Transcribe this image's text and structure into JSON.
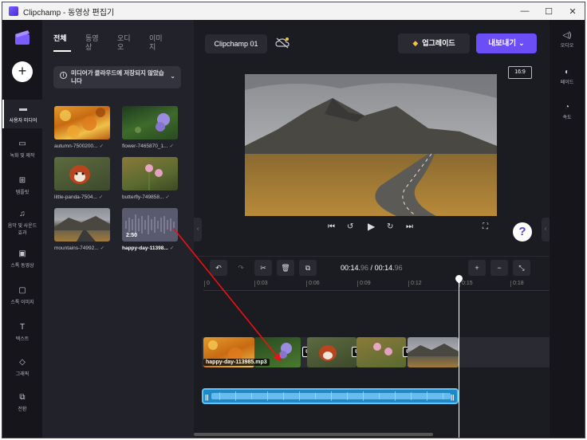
{
  "window": {
    "title": "Clipchamp - 동영상 편집기",
    "controls": [
      "—",
      "☐",
      "✕"
    ]
  },
  "left_nav": {
    "plus": "+",
    "items": [
      {
        "label": "사용자 미디어",
        "icon": "folder-icon",
        "glyph": "▬"
      },
      {
        "label": "녹화 및 제작",
        "icon": "camera-icon",
        "glyph": "▭"
      },
      {
        "label": "템플릿",
        "icon": "template-icon",
        "glyph": "⊞"
      },
      {
        "label": "음악 및 사운드 효과",
        "icon": "music-icon",
        "glyph": "♫"
      },
      {
        "label": "스톡 동영상",
        "icon": "film-icon",
        "glyph": "▣"
      },
      {
        "label": "스톡 이미지",
        "icon": "image-icon",
        "glyph": "▢"
      },
      {
        "label": "텍스트",
        "icon": "text-icon",
        "glyph": "T"
      },
      {
        "label": "그래픽",
        "icon": "shapes-icon",
        "glyph": "◇"
      },
      {
        "label": "전환",
        "icon": "transition-icon",
        "glyph": "⧉"
      }
    ]
  },
  "media_panel": {
    "tabs": [
      "전체",
      "동영상",
      "오디오",
      "이미지"
    ],
    "notice": "미디어가 클라우드에 저장되지 않았습니다",
    "items": [
      {
        "label": "autumn-7500200...",
        "check": "✓"
      },
      {
        "label": "flower-7465870_1...",
        "check": "✓"
      },
      {
        "label": "little-panda-7504...",
        "check": "✓"
      },
      {
        "label": "butterfly-749858...",
        "check": "✓"
      },
      {
        "label": "mountains-74992...",
        "check": "✓"
      },
      {
        "label": "happy-day-11398...",
        "check": "✓",
        "duration": "2:50"
      }
    ]
  },
  "header": {
    "project_title": "Clipchamp 01",
    "upgrade_label": "업그레이드",
    "export_label": "내보내기",
    "aspect_ratio": "16:9"
  },
  "toolbar": {
    "current_time": "00:14.",
    "current_frac": "96",
    "separator": " / ",
    "total_time": "00:14.",
    "total_frac": "96"
  },
  "ruler_ticks": [
    "0",
    "0:03",
    "0:06",
    "0:09",
    "0:12",
    "0:15",
    "0:18"
  ],
  "timeline": {
    "drag_label": "happy-day-113985.mp3",
    "audio_markers": [
      "||",
      "||"
    ]
  },
  "right_nav": {
    "items": [
      {
        "label": "오디오",
        "icon": "speaker-icon",
        "glyph": "🔈"
      },
      {
        "label": "페이드",
        "icon": "fade-icon",
        "glyph": "◐"
      },
      {
        "label": "속도",
        "icon": "speed-icon",
        "glyph": "◔"
      }
    ]
  },
  "help": "?"
}
